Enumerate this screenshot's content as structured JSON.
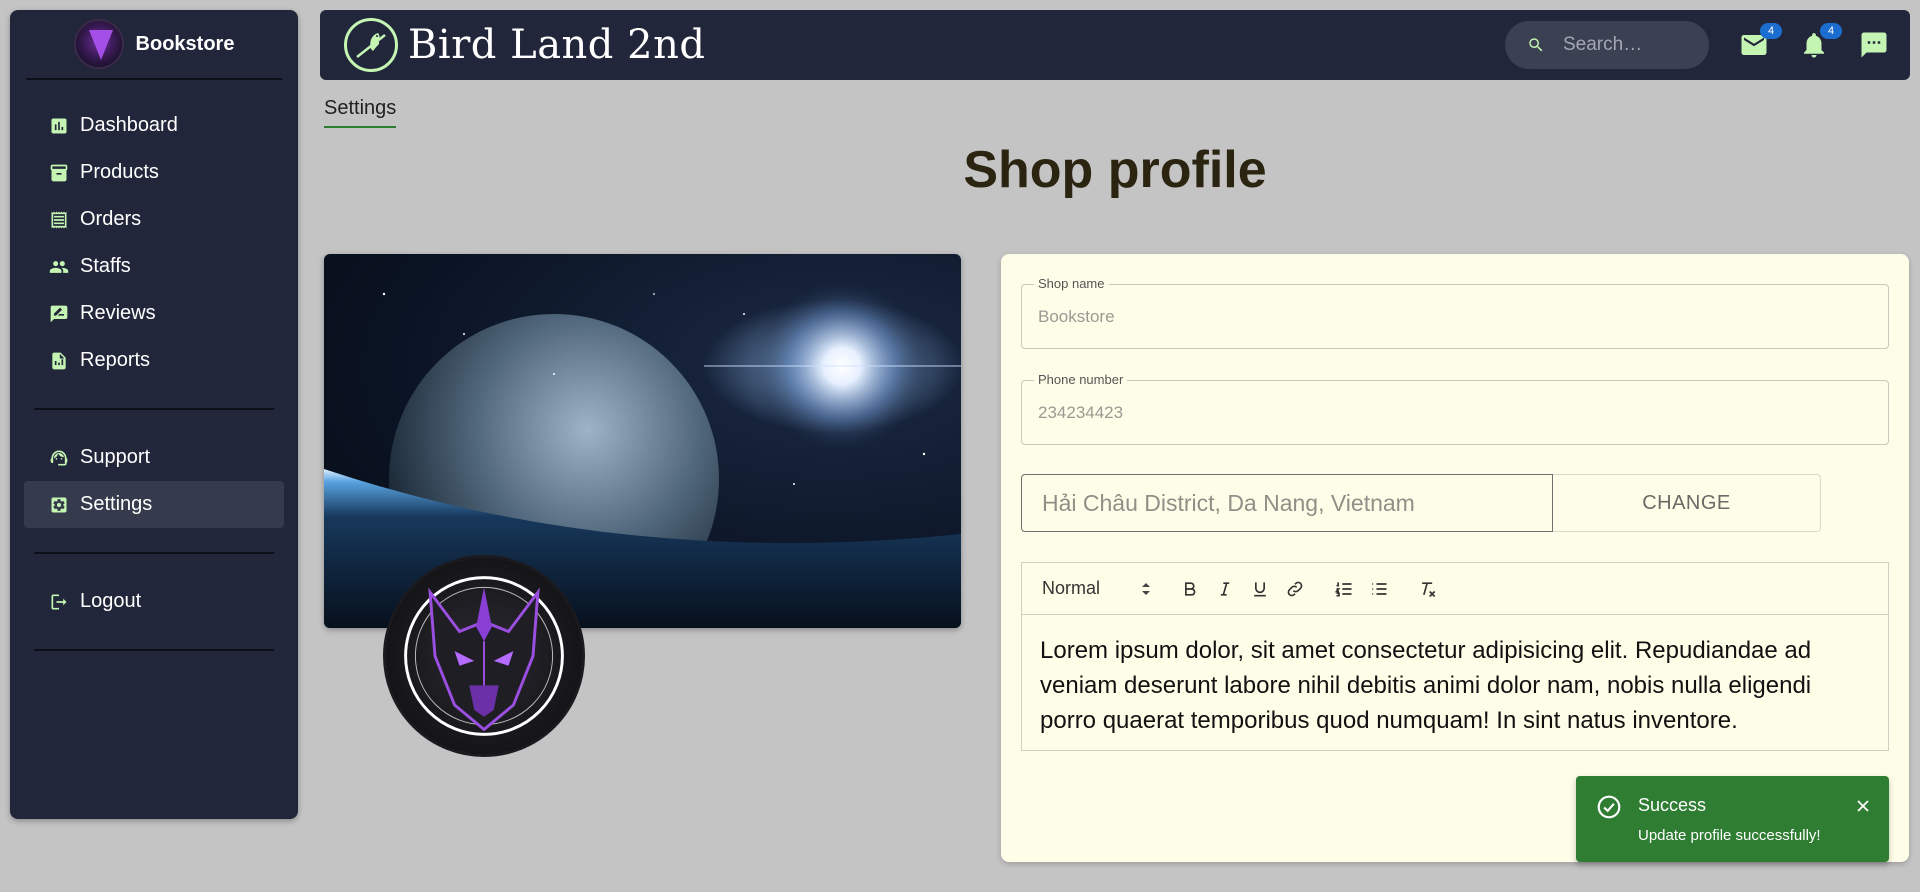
{
  "sidebar": {
    "brand_name": "Bookstore",
    "items": [
      {
        "label": "Dashboard",
        "icon": "dashboard-icon"
      },
      {
        "label": "Products",
        "icon": "archive-icon"
      },
      {
        "label": "Orders",
        "icon": "receipt-icon"
      },
      {
        "label": "Staffs",
        "icon": "people-icon"
      },
      {
        "label": "Reviews",
        "icon": "rate-review-icon"
      },
      {
        "label": "Reports",
        "icon": "report-icon"
      }
    ],
    "secondary": [
      {
        "label": "Support",
        "icon": "support-agent-icon"
      },
      {
        "label": "Settings",
        "icon": "settings-icon",
        "active": true
      }
    ],
    "logout_label": "Logout"
  },
  "topbar": {
    "title": "Bird Land 2nd",
    "search_placeholder": "Search…",
    "mail_count": "4",
    "notification_count": "4"
  },
  "breadcrumb": "Settings",
  "page_title": "Shop profile",
  "form": {
    "shop_name_label": "Shop name",
    "shop_name_placeholder": "Bookstore",
    "phone_label": "Phone number",
    "phone_placeholder": "234234423",
    "address_placeholder": "Hải Châu District, Da Nang, Vietnam",
    "change_label": "CHANGE",
    "editor_format": "Normal",
    "description": "Lorem ipsum dolor, sit amet consectetur adipisicing elit. Repudiandae ad veniam deserunt labore nihil debitis animi dolor nam, nobis nulla eligendi porro quaerat temporibus quod numquam! In sint natus inventore."
  },
  "toast": {
    "title": "Success",
    "message": "Update profile successfully!"
  },
  "colors": {
    "accent": "#c4f5b3",
    "sidebar_bg": "#22263a",
    "success": "#2e7d32",
    "badge": "#1c6dd0",
    "card_bg": "#fefee8"
  }
}
